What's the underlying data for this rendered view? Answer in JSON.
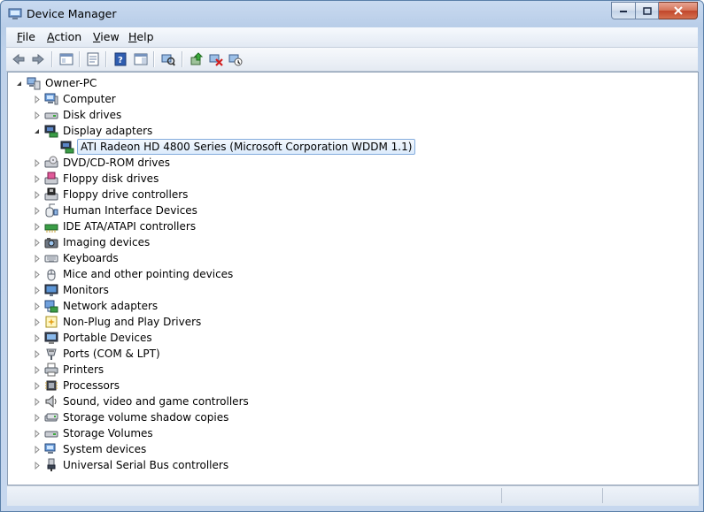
{
  "window": {
    "title": "Device Manager"
  },
  "menu": [
    {
      "label": "File",
      "access": "F",
      "rest": "ile"
    },
    {
      "label": "Action",
      "access": "A",
      "rest": "ction"
    },
    {
      "label": "View",
      "access": "V",
      "rest": "iew"
    },
    {
      "label": "Help",
      "access": "H",
      "rest": "elp"
    }
  ],
  "toolbar": [
    {
      "name": "back-button",
      "icon": "back-arrow-icon"
    },
    {
      "name": "forward-button",
      "icon": "forward-arrow-icon"
    },
    {
      "name": "show-hide-console-tree-button",
      "icon": "console-tree-icon"
    },
    {
      "name": "properties-button",
      "icon": "properties-icon"
    },
    {
      "name": "help-button",
      "icon": "help-icon"
    },
    {
      "name": "show-action-pane-button",
      "icon": "action-pane-icon"
    },
    {
      "name": "scan-hardware-changes-button",
      "icon": "scan-hardware-icon"
    },
    {
      "name": "update-driver-button",
      "icon": "update-driver-icon"
    },
    {
      "name": "uninstall-button",
      "icon": "uninstall-icon"
    },
    {
      "name": "disable-button",
      "icon": "disable-icon"
    }
  ],
  "tree": {
    "root": "Owner-PC",
    "categories": [
      {
        "label": "Computer",
        "icon": "computer-icon"
      },
      {
        "label": "Disk drives",
        "icon": "disk-drive-icon"
      },
      {
        "label": "Display adapters",
        "icon": "display-adapter-icon",
        "expanded": true,
        "children": [
          "ATI Radeon HD 4800 Series  (Microsoft Corporation WDDM 1.1)"
        ]
      },
      {
        "label": "DVD/CD-ROM drives",
        "icon": "dvd-drive-icon"
      },
      {
        "label": "Floppy disk drives",
        "icon": "floppy-disk-icon"
      },
      {
        "label": "Floppy drive controllers",
        "icon": "floppy-controller-icon"
      },
      {
        "label": "Human Interface Devices",
        "icon": "hid-icon"
      },
      {
        "label": "IDE ATA/ATAPI controllers",
        "icon": "ide-controller-icon"
      },
      {
        "label": "Imaging devices",
        "icon": "camera-icon"
      },
      {
        "label": "Keyboards",
        "icon": "keyboard-icon"
      },
      {
        "label": "Mice and other pointing devices",
        "icon": "mouse-icon"
      },
      {
        "label": "Monitors",
        "icon": "monitor-icon"
      },
      {
        "label": "Network adapters",
        "icon": "network-adapter-icon"
      },
      {
        "label": "Non-Plug and Play Drivers",
        "icon": "driver-icon"
      },
      {
        "label": "Portable Devices",
        "icon": "portable-device-icon"
      },
      {
        "label": "Ports (COM & LPT)",
        "icon": "port-icon"
      },
      {
        "label": "Printers",
        "icon": "printer-icon"
      },
      {
        "label": "Processors",
        "icon": "processor-icon"
      },
      {
        "label": "Sound, video and game controllers",
        "icon": "speaker-icon"
      },
      {
        "label": "Storage volume shadow copies",
        "icon": "shadow-copy-icon"
      },
      {
        "label": "Storage Volumes",
        "icon": "storage-volume-icon"
      },
      {
        "label": "System devices",
        "icon": "system-device-icon"
      },
      {
        "label": "Universal Serial Bus controllers",
        "icon": "usb-icon"
      }
    ]
  },
  "colors": {
    "selection_border": "#84acdd",
    "selection_fill": "#dcebfc",
    "close_button": "#c1462a"
  }
}
